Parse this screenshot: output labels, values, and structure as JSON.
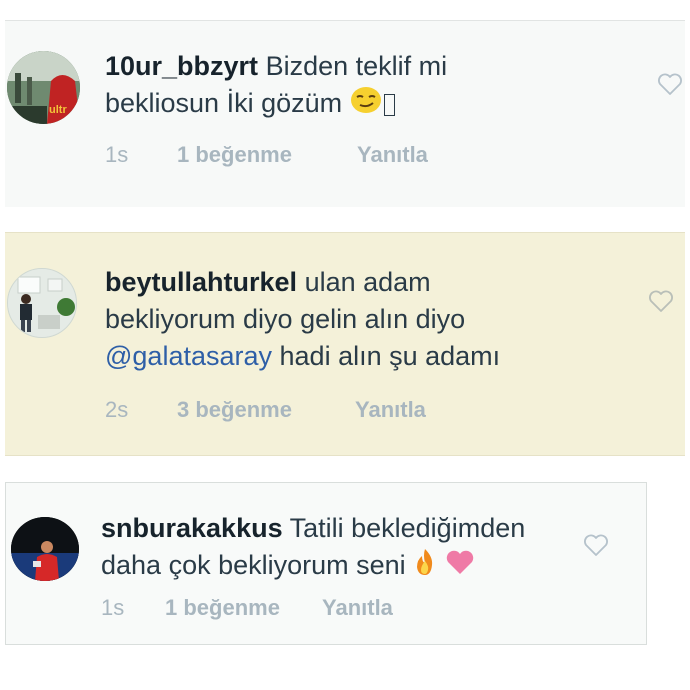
{
  "comments": [
    {
      "username": "10ur_bbzyrt",
      "text_line1": "Bizden teklif mi",
      "text_line2": "bekliosun İki gözüm",
      "time": "1s",
      "likes": "1 beğenme",
      "reply": "Yanıtla",
      "highlighted": false
    },
    {
      "username": "beytullahturkel",
      "text_line1": "ulan adam",
      "text_line2": "bekliyorum diyo gelin alın diyo",
      "mention": "@galatasaray",
      "text_line3": "hadi alın şu adamı",
      "time": "2s",
      "likes": "3 beğenme",
      "reply": "Yanıtla",
      "highlighted": true
    },
    {
      "username": "snburakakkus",
      "text_line1": "Tatili beklediğimden",
      "text_line2": "daha çok bekliyorum seni",
      "time": "1s",
      "likes": "1 beğenme",
      "reply": "Yanıtla",
      "highlighted": false
    }
  ],
  "icons": {
    "like": "heart-outline-icon",
    "emoji_smirk": "smirking-face-emoji",
    "emoji_fire": "fire-emoji",
    "emoji_heart": "pink-heart-emoji"
  },
  "colors": {
    "highlight_bg": "#f4f1d9",
    "card_bg": "#f7f9f8",
    "text": "#2a3b47",
    "mention": "#2e5fa7",
    "meta": "#a8b6bf"
  }
}
